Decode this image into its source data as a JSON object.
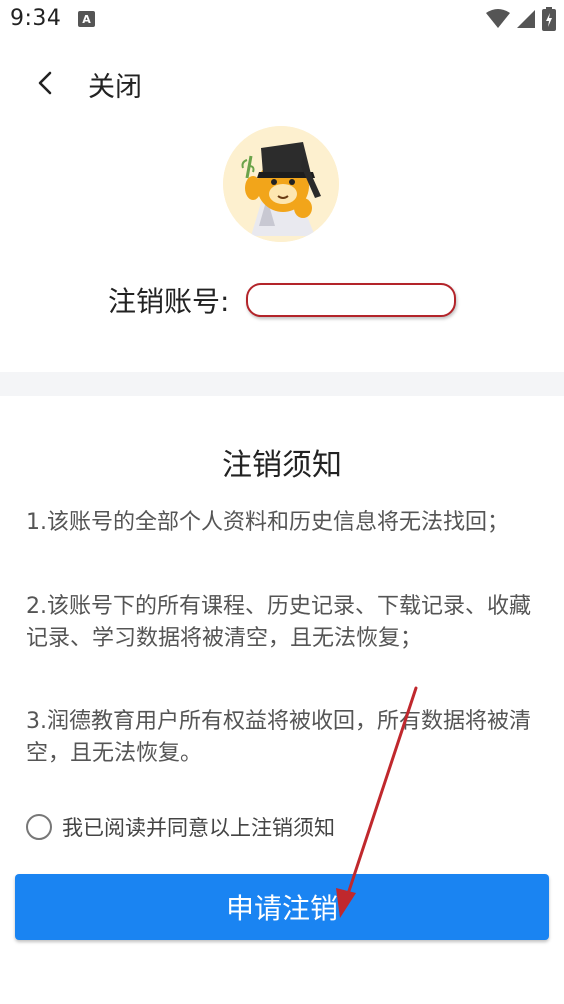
{
  "status_bar": {
    "time": "9:34",
    "notification_icon": "A"
  },
  "header": {
    "back_icon": "chevron-left-icon",
    "title": "关闭"
  },
  "account": {
    "label": "注销账号:",
    "value": ""
  },
  "notice": {
    "title": "注销须知",
    "items": [
      "1.该账号的全部个人资料和历史信息将无法找回；",
      "2.该账号下的所有课程、历史记录、下载记录、收藏记录、学习数据将被清空，且无法恢复；",
      "3.润德教育用户所有权益将被收回，所有数据将被清空，且无法恢复。"
    ]
  },
  "agreement": {
    "checked": false,
    "label": "我已阅读并同意以上注销须知"
  },
  "submit": {
    "label": "申请注销",
    "color": "#1a84f2"
  },
  "annotation": {
    "redaction_border_color": "#b3242a",
    "arrow_color": "#c0282d"
  }
}
